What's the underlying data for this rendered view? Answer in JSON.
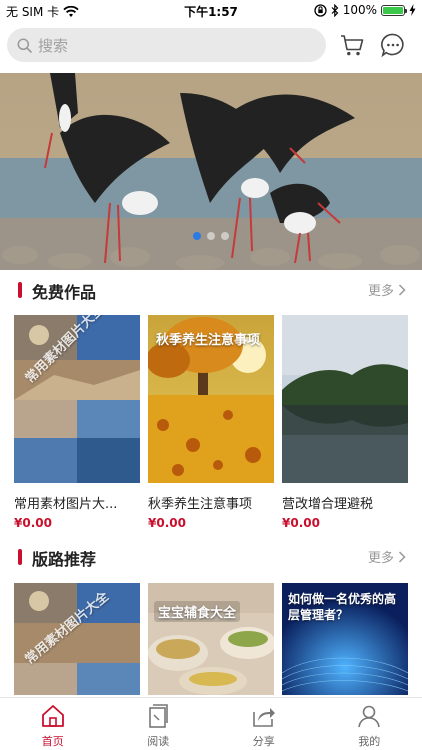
{
  "status": {
    "carrier": "无 SIM 卡",
    "time": "下午1:57",
    "battery": "100%",
    "battery_level": 1.0
  },
  "search": {
    "placeholder": "搜索"
  },
  "banner": {
    "slide_count": 3,
    "active_slide": 0
  },
  "sections": [
    {
      "title": "免费作品",
      "more": "更多",
      "items": [
        {
          "title": "常用素材图片大...",
          "price": "¥0.00",
          "overlay": "常用素材图片大全"
        },
        {
          "title": "秋季养生注意事项",
          "price": "¥0.00",
          "overlay": "秋季养生注意事项"
        },
        {
          "title": "营改增合理避税",
          "price": "¥0.00",
          "overlay": ""
        }
      ]
    },
    {
      "title": "版路推荐",
      "more": "更多",
      "items": [
        {
          "overlay": "常用素材图片大全"
        },
        {
          "overlay": "宝宝辅食大全"
        },
        {
          "overlay": "如何做一名优秀的高层管理者？"
        }
      ]
    }
  ],
  "tabs": [
    {
      "label": "首页",
      "icon": "home-icon",
      "active": true
    },
    {
      "label": "阅读",
      "icon": "book-icon",
      "active": false
    },
    {
      "label": "分享",
      "icon": "share-icon",
      "active": false
    },
    {
      "label": "我的",
      "icon": "user-icon",
      "active": false
    }
  ],
  "colors": {
    "accent": "#c8102e",
    "dot_active": "#2a7be4"
  }
}
